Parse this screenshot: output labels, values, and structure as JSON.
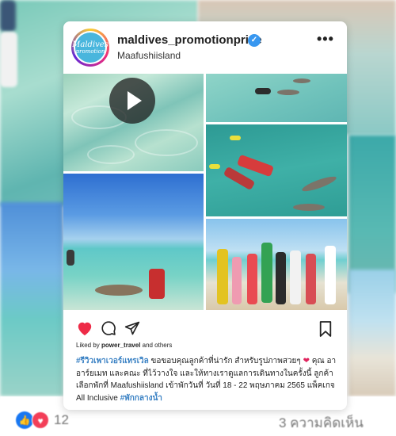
{
  "background": {
    "reactions_count": "12",
    "comments_label": "3 ความคิดเห็น"
  },
  "post": {
    "avatar": {
      "line1": "Maldives",
      "line2": "promotion"
    },
    "username": "maldives_promotionprice",
    "location": "Maafushiisland",
    "more_label": "•••",
    "liked_by_prefix": "Liked by ",
    "liked_by_user": "power_travel",
    "liked_by_suffix": " and others",
    "caption_hashtag_1": "#รีวิวเพาเวอร์แทรเวิล",
    "caption_text_1": " ขอขอบคุณลูกค้าที่น่ารัก สำหรับรูปภาพสวยๆ ",
    "caption_heart": "❤",
    "caption_text_2": " คุณ อาอาร์ยเมท และคณะ ที่ไว้วางใจ และให้ทางเราดูแลการเดินทางในครั้งนี้ ลูกค้าเลือกพักที่ Maafushiisland เข้าพักวันที่ วันที่ 18 - 22 พฤษภาคม 2565 แพ็คเกจ All Inclusive ",
    "caption_hashtag_2": "#พักกลางน้ำ"
  },
  "colors": {
    "accent_link": "#3b82c4",
    "heart": "#e0245e",
    "verified": "#3897f0"
  },
  "icons": [
    "verified-icon",
    "more-options-icon",
    "play-icon",
    "heart-icon",
    "comment-icon",
    "share-icon",
    "bookmark-icon",
    "like-reaction-icon",
    "love-reaction-icon"
  ]
}
